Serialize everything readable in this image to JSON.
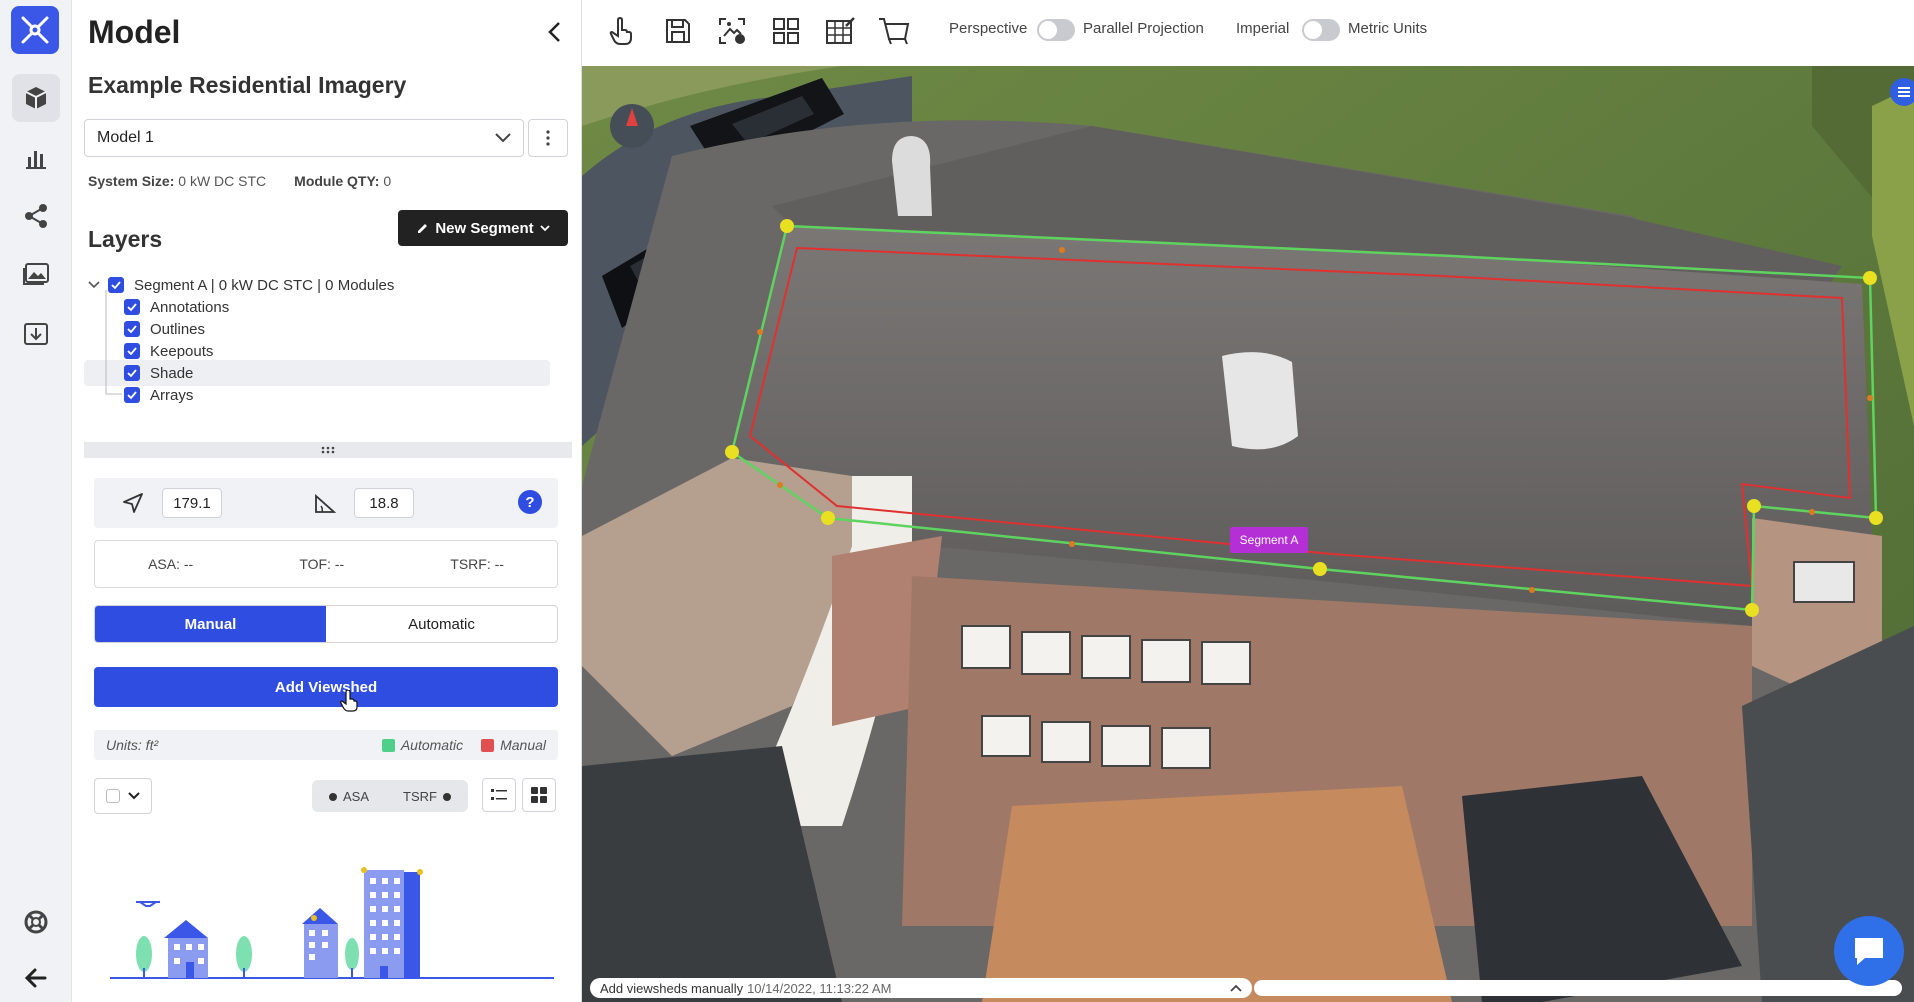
{
  "sidebar": {
    "items": [
      {
        "name": "model",
        "icon": "cube-icon"
      },
      {
        "name": "analytics",
        "icon": "bar-chart-icon"
      },
      {
        "name": "share",
        "icon": "share-icon"
      },
      {
        "name": "images",
        "icon": "image-icon"
      },
      {
        "name": "import",
        "icon": "download-tray-icon"
      },
      {
        "name": "help",
        "icon": "lifebuoy-icon"
      },
      {
        "name": "back",
        "icon": "arrow-left-icon"
      }
    ]
  },
  "panel": {
    "title": "Model",
    "project_title": "Example Residential Imagery",
    "model_select": {
      "value": "Model 1"
    },
    "system_size_label": "System Size:",
    "system_size_value": "0 kW DC STC",
    "module_qty_label": "Module QTY:",
    "module_qty_value": "0",
    "layers_heading": "Layers",
    "new_segment_label": "New Segment",
    "tree": {
      "root": "Segment A | 0 kW DC STC | 0 Modules",
      "children": [
        "Annotations",
        "Outlines",
        "Keepouts",
        "Shade",
        "Arrays"
      ]
    },
    "azimuth": "179.1",
    "pitch": "18.8",
    "help_label": "?",
    "metrics": {
      "asa": "ASA: --",
      "tof": "TOF: --",
      "tsrf": "TSRF: --"
    },
    "mode": {
      "manual": "Manual",
      "automatic": "Automatic"
    },
    "add_viewshed_label": "Add Viewshed",
    "units_label": "Units: ft²",
    "legend": [
      {
        "label": "Automatic",
        "color": "#4fd08a"
      },
      {
        "label": "Manual",
        "color": "#e05050"
      }
    ],
    "pill": {
      "left": "ASA",
      "right": "TSRF"
    }
  },
  "toolbar": {
    "tools": [
      "hand-pointer-icon",
      "save-icon",
      "image-pin-icon",
      "layout-grid-icon",
      "edit-grid-icon",
      "cart-frame-icon"
    ],
    "perspective_label": "Perspective",
    "parallel_label": "Parallel Projection",
    "imperial_label": "Imperial",
    "metric_label": "Metric Units"
  },
  "viewport": {
    "segment_label": "Segment A",
    "status_text": "Add viewsheds manually",
    "status_time": "10/14/2022, 11:13:22 AM"
  },
  "colors": {
    "accent": "#2f4de0",
    "segment_outline": "#5fd35f",
    "setback": "#e03030",
    "vertex": "#e8e020"
  }
}
